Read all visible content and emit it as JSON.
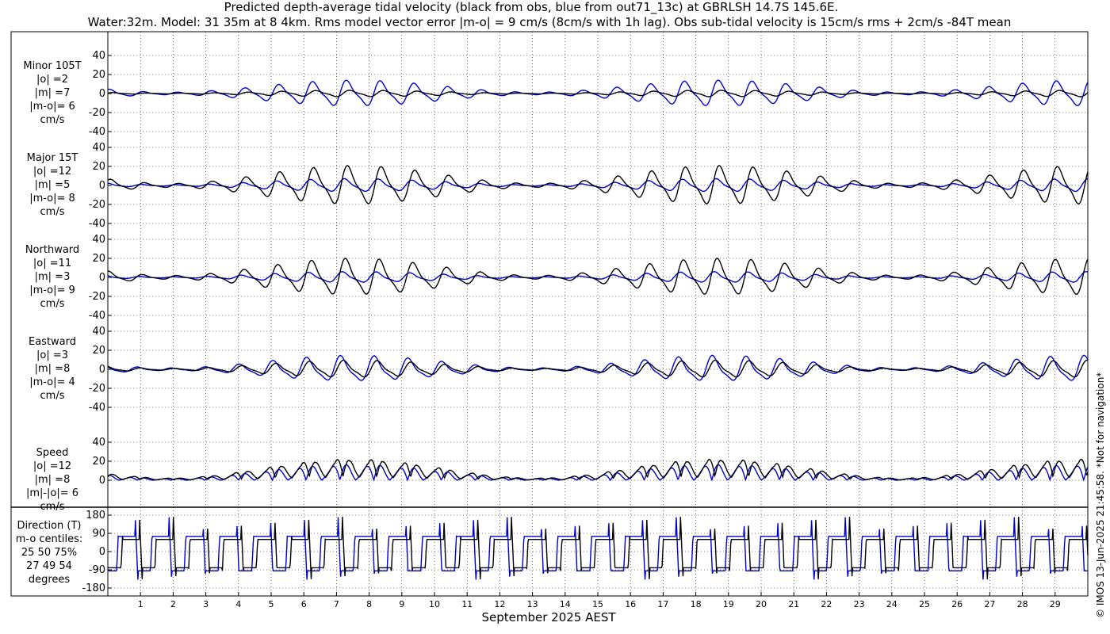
{
  "colors": {
    "obs": "#000000",
    "model": "#0000cc",
    "grid": "#000000"
  },
  "title_lines": [
    "Predicted depth-average tidal velocity (black from obs, blue from out71_13c) at GBRLSH 14.7S 145.6E.",
    "Water:32m. Model: 31 35m at 8 4km. Rms model vector error |m-o| = 9 cm/s (8cm/s with 1h lag). Obs sub-tidal velocity is 15cm/s rms + 2cm/s -84T mean"
  ],
  "side_note": "© IMOS 13-Jun-2025 21:45:58. *Not for navigation*",
  "chart_data": {
    "type": "line",
    "xlabel": "September 2025 AEST",
    "x_ticks": [
      "1",
      "2",
      "3",
      "4",
      "5",
      "6",
      "7",
      "8",
      "9",
      "10",
      "11",
      "12",
      "13",
      "14",
      "15",
      "16",
      "17",
      "18",
      "19",
      "20",
      "21",
      "22",
      "23",
      "24",
      "25",
      "26",
      "27",
      "28",
      "29"
    ],
    "xlim_days": [
      0,
      30
    ],
    "series_legend": {
      "obs": "black from obs",
      "model": "blue from out71_13c"
    },
    "panels": [
      {
        "id": "minor",
        "label_lines": [
          "Minor 105T",
          "|o| =2",
          "|m| =7",
          "|m-o|= 6",
          "cm/s"
        ],
        "ylim": [
          -40,
          40
        ],
        "yticks": [
          "40",
          "20",
          "0",
          "-20",
          "-40"
        ],
        "obs_amp": 3,
        "model_amp": 12,
        "kind": "signed"
      },
      {
        "id": "major",
        "label_lines": [
          "Major 15T",
          "|o| =12",
          "|m| =5",
          "|m-o|= 8",
          "cm/s"
        ],
        "ylim": [
          -40,
          40
        ],
        "yticks": [
          "40",
          "20",
          "0",
          "-20",
          "-40"
        ],
        "obs_amp": 18,
        "model_amp": 6,
        "kind": "signed"
      },
      {
        "id": "north",
        "label_lines": [
          "Northward",
          "|o| =11",
          "|m| =3",
          "|m-o|= 9",
          "cm/s"
        ],
        "ylim": [
          -40,
          40
        ],
        "yticks": [
          "40",
          "20",
          "0",
          "-20",
          "-40"
        ],
        "obs_amp": 17,
        "model_amp": 5,
        "kind": "signed"
      },
      {
        "id": "east",
        "label_lines": [
          "Eastward",
          "|o| =3",
          "|m| =8",
          "|m-o|= 4",
          "cm/s"
        ],
        "ylim": [
          -40,
          40
        ],
        "yticks": [
          "40",
          "20",
          "0",
          "-20",
          "-40"
        ],
        "obs_amp": 8,
        "model_amp": 12,
        "kind": "signed"
      },
      {
        "id": "speed",
        "label_lines": [
          "Speed",
          "|o| =12",
          "|m| =8",
          "|m|-|o|= 6",
          "cm/s"
        ],
        "ylim": [
          0,
          40
        ],
        "yticks": [
          "40",
          "20",
          "0"
        ],
        "obs_amp": 20,
        "model_amp": 14,
        "kind": "speed"
      }
    ],
    "direction_panel": {
      "label_lines": [
        "Direction (T)",
        "m-o centiles:",
        "25  50  75%",
        "27  49  54",
        "degrees"
      ],
      "ylim": [
        -180,
        180
      ],
      "yticks": [
        "180",
        "90",
        "0",
        "-90",
        "-180"
      ]
    }
  }
}
